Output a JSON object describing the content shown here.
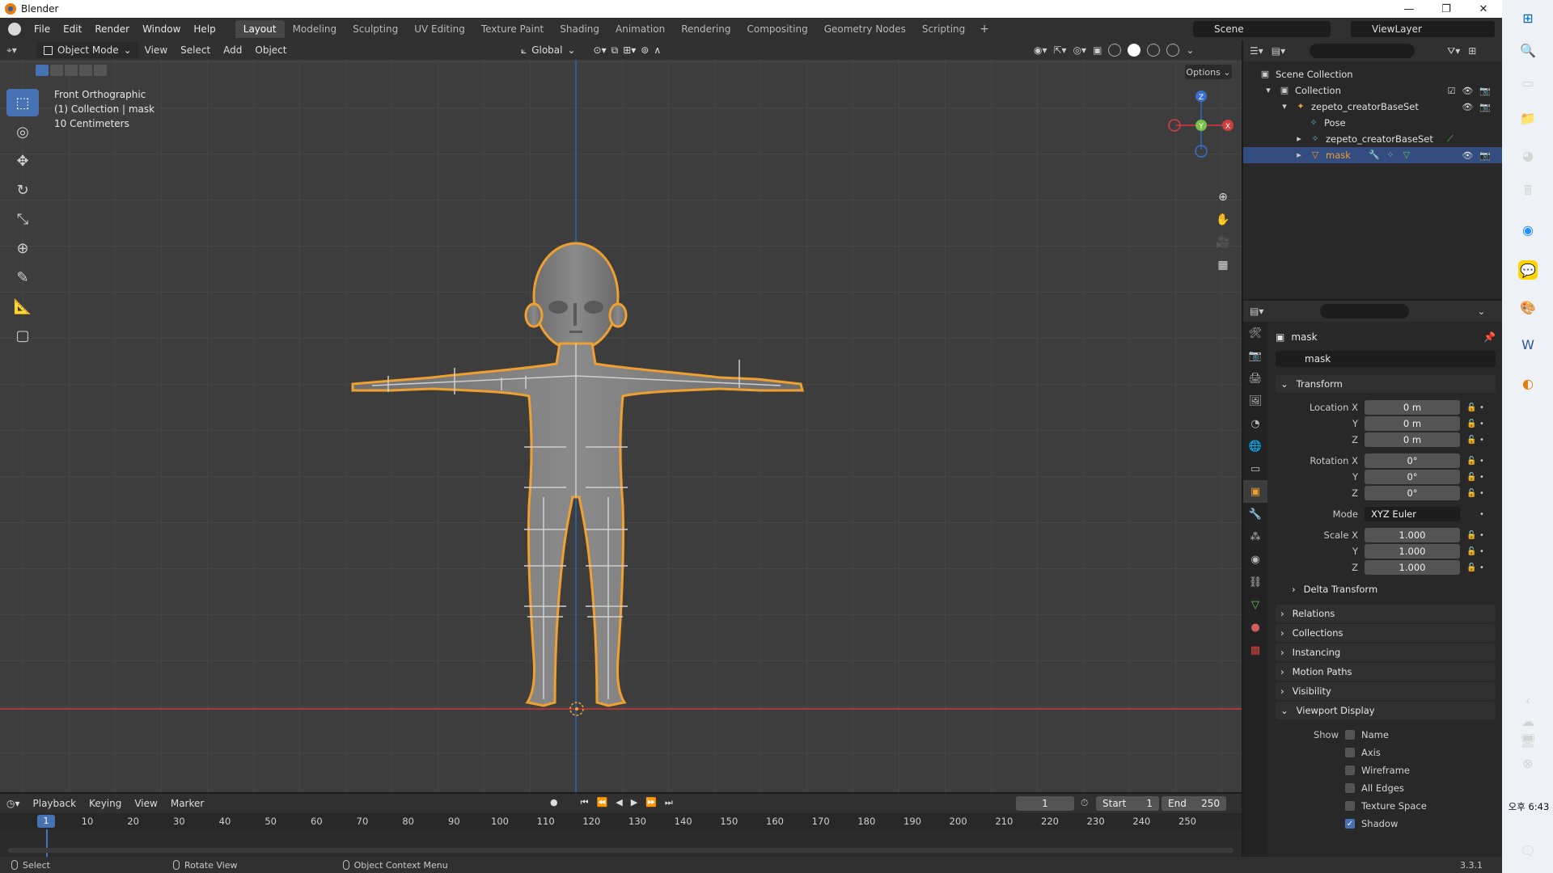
{
  "window": {
    "title": "Blender",
    "buttons": [
      "—",
      "❐",
      "✕"
    ]
  },
  "menu": [
    "File",
    "Edit",
    "Render",
    "Window",
    "Help"
  ],
  "workspaces": {
    "tabs": [
      "Layout",
      "Modeling",
      "Sculpting",
      "UV Editing",
      "Texture Paint",
      "Shading",
      "Animation",
      "Rendering",
      "Compositing",
      "Geometry Nodes",
      "Scripting"
    ],
    "active": "Layout",
    "add": "+"
  },
  "scene": "Scene",
  "view_layer": "ViewLayer",
  "viewport": {
    "mode": "Object Mode",
    "menus": [
      "View",
      "Select",
      "Add",
      "Object"
    ],
    "orientation": "Global",
    "options_label": "Options",
    "info": [
      "Front Orthographic",
      "(1) Collection | mask",
      "10 Centimeters"
    ],
    "gizmo": {
      "z": "Z",
      "y": "Y",
      "x": "X"
    },
    "colors": {
      "x_axis": "#b03a3a",
      "z_axis": "#2c5ea0",
      "selection_outline": "#f0a030",
      "accent": "#4772b3"
    }
  },
  "outliner": {
    "items": [
      {
        "label": "Scene Collection",
        "icon": "collection-icon",
        "depth": 0
      },
      {
        "label": "Collection",
        "icon": "collection-icon",
        "depth": 1
      },
      {
        "label": "zepeto_creatorBaseSet",
        "icon": "armature-icon",
        "depth": 2
      },
      {
        "label": "Pose",
        "icon": "pose-icon",
        "depth": 3
      },
      {
        "label": "zepeto_creatorBaseSet",
        "icon": "armature-data-icon",
        "depth": 3
      },
      {
        "label": "mask",
        "icon": "mesh-icon",
        "depth": 3,
        "selected": true
      }
    ]
  },
  "properties": {
    "object_name": "mask",
    "object_field": "mask",
    "transform": {
      "title": "Transform",
      "location_label": "Location X",
      "location": [
        "0 m",
        "0 m",
        "0 m"
      ],
      "rotation_label": "Rotation X",
      "rotation": [
        "0°",
        "0°",
        "0°"
      ],
      "mode_label": "Mode",
      "mode": "XYZ Euler",
      "scale_label": "Scale X",
      "scale": [
        "1.000",
        "1.000",
        "1.000"
      ],
      "y_label": "Y",
      "z_label": "Z"
    },
    "delta_transform": "Delta Transform",
    "panels": [
      "Relations",
      "Collections",
      "Instancing",
      "Motion Paths",
      "Visibility"
    ],
    "viewport_display": {
      "title": "Viewport Display",
      "show_label": "Show",
      "options": [
        {
          "label": "Name",
          "checked": false
        },
        {
          "label": "Axis",
          "checked": false
        },
        {
          "label": "Wireframe",
          "checked": false
        },
        {
          "label": "All Edges",
          "checked": false
        },
        {
          "label": "Texture Space",
          "checked": false
        },
        {
          "label": "Shadow",
          "checked": true
        }
      ]
    }
  },
  "timeline": {
    "menus": [
      "Playback",
      "Keying",
      "View",
      "Marker"
    ],
    "current_frame": "1",
    "start_label": "Start",
    "start": "1",
    "end_label": "End",
    "end": "250",
    "ticks": [
      "1",
      "10",
      "20",
      "30",
      "40",
      "50",
      "60",
      "70",
      "80",
      "90",
      "100",
      "110",
      "120",
      "130",
      "140",
      "150",
      "160",
      "170",
      "180",
      "190",
      "200",
      "210",
      "220",
      "230",
      "240",
      "250"
    ]
  },
  "statusbar": {
    "select": "Select",
    "rotate": "Rotate View",
    "context": "Object Context Menu",
    "version": "3.3.1"
  },
  "taskbar": {
    "clock": "오후 6:43"
  }
}
